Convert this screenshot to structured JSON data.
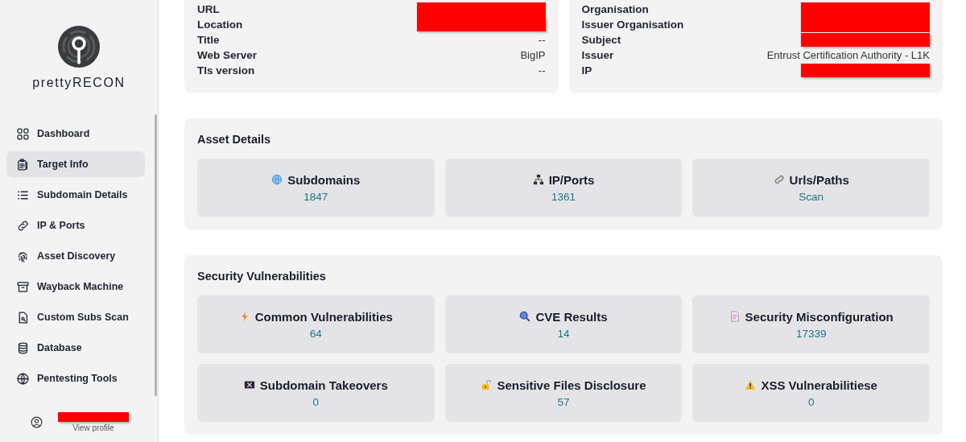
{
  "sidebar": {
    "logo_text": "prettyRECON",
    "items": [
      {
        "label": "Dashboard",
        "selected": false
      },
      {
        "label": "Target Info",
        "selected": true
      },
      {
        "label": "Subdomain Details",
        "selected": false
      },
      {
        "label": "IP & Ports",
        "selected": false
      },
      {
        "label": "Asset Discovery",
        "selected": false
      },
      {
        "label": "Wayback Machine",
        "selected": false
      },
      {
        "label": "Custom Subs Scan",
        "selected": false
      },
      {
        "label": "Database",
        "selected": false
      },
      {
        "label": "Pentesting Tools",
        "selected": false
      }
    ],
    "profile": {
      "name_redacted": true,
      "link": "View profile"
    }
  },
  "info_cards": [
    {
      "rows": [
        {
          "label": "URL",
          "redacted": true
        },
        {
          "label": "Location",
          "redacted": true
        },
        {
          "label": "Title",
          "value": "--",
          "redacted": false
        },
        {
          "label": "Web Server",
          "value": "BigIP",
          "redacted": false
        },
        {
          "label": "Tls version",
          "value": "--",
          "redacted": false
        }
      ]
    },
    {
      "rows": [
        {
          "label": "Organisation",
          "redacted": true
        },
        {
          "label": "Issuer Organisation",
          "redacted": true
        },
        {
          "label": "Subject",
          "redacted": true
        },
        {
          "label": "Issuer",
          "value": "Entrust Certification Authority - L1K",
          "redacted": false
        },
        {
          "label": "IP",
          "redacted": true
        }
      ]
    }
  ],
  "sections": [
    {
      "title": "Asset Details",
      "tiles": [
        {
          "label": "Subdomains",
          "value": "1847"
        },
        {
          "label": "IP/Ports",
          "value": "1361"
        },
        {
          "label": "Urls/Paths",
          "value": "Scan"
        }
      ]
    },
    {
      "title": "Security Vulnerabilities",
      "tiles": [
        {
          "label": "Common Vulnerabilities",
          "value": "64"
        },
        {
          "label": "CVE Results",
          "value": "14"
        },
        {
          "label": "Security Misconfiguration",
          "value": "17339"
        },
        {
          "label": "Subdomain Takeovers",
          "value": "0"
        },
        {
          "label": "Sensitive Files Disclosure",
          "value": "57"
        },
        {
          "label": "XSS Vulnerabilitiese",
          "value": "0"
        }
      ]
    }
  ]
}
